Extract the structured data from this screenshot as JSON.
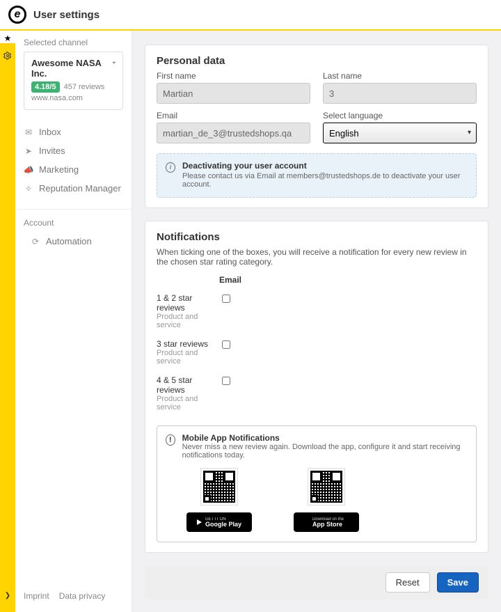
{
  "header": {
    "title": "User settings"
  },
  "sidebar": {
    "selected_channel_label": "Selected channel",
    "channel": {
      "name": "Awesome NASA Inc.",
      "rating": "4.18/5",
      "reviews": "457 reviews",
      "domain": "www.nasa.com"
    },
    "nav": [
      {
        "label": "Inbox"
      },
      {
        "label": "Invites"
      },
      {
        "label": "Marketing"
      },
      {
        "label": "Reputation Manager"
      }
    ],
    "account_label": "Account",
    "account_items": [
      {
        "label": "Automation"
      }
    ],
    "footer": {
      "imprint": "Imprint",
      "privacy": "Data privacy"
    }
  },
  "personal": {
    "heading": "Personal data",
    "first_name_label": "First name",
    "first_name_value": "Martian",
    "last_name_label": "Last name",
    "last_name_value": "3",
    "email_label": "Email",
    "email_value": "martian_de_3@trustedshops.qa",
    "language_label": "Select language",
    "language_value": "English",
    "deactivate_title": "Deactivating your user account",
    "deactivate_text": "Please contact us via Email at members@trustedshops.de to deactivate your user account."
  },
  "notifications": {
    "heading": "Notifications",
    "description": "When ticking one of the boxes, you will receive a notification for every new review in the chosen star rating category.",
    "col_email": "Email",
    "rows": [
      {
        "title": "1 & 2 star reviews",
        "subtitle": "Product and service"
      },
      {
        "title": "3 star reviews",
        "subtitle": "Product and service"
      },
      {
        "title": "4 & 5 star reviews",
        "subtitle": "Product and service"
      }
    ],
    "mobile": {
      "title": "Mobile App Notifications",
      "text": "Never miss a new review again. Download the app, configure it and start receiving notifications today.",
      "google_small": "GET IT ON",
      "google_big": "Google Play",
      "apple_small": "Download on the",
      "apple_big": "App Store"
    }
  },
  "actions": {
    "reset": "Reset",
    "save": "Save"
  }
}
